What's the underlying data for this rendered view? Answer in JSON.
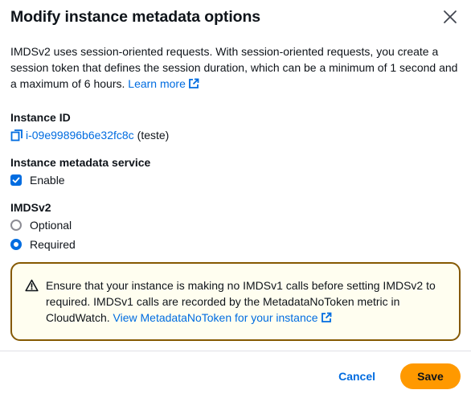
{
  "modal": {
    "title": "Modify instance metadata options",
    "close_icon": "close-icon"
  },
  "description": {
    "text": "IMDSv2 uses session-oriented requests. With session-oriented requests, you create a session token that defines the session duration, which can be a minimum of 1 second and a maximum of 6 hours.",
    "link_label": "Learn more",
    "link_icon": "external-link-icon"
  },
  "instance_id": {
    "label": "Instance ID",
    "copy_icon": "copy-icon",
    "value": "i-09e99896b6e32fc8c",
    "name": "(teste)"
  },
  "metadata_service": {
    "label": "Instance metadata service",
    "checkbox_label": "Enable",
    "checked": true
  },
  "imdsv2": {
    "label": "IMDSv2",
    "options": [
      {
        "label": "Optional",
        "selected": false
      },
      {
        "label": "Required",
        "selected": true
      }
    ]
  },
  "alert": {
    "icon": "warning-icon",
    "text": "Ensure that your instance is making no IMDSv1 calls before setting IMDSv2 to required. IMDSv1 calls are recorded by the MetadataNoToken metric in CloudWatch.",
    "link_label": "View MetadataNoToken for your instance",
    "link_icon": "external-link-icon"
  },
  "footer": {
    "cancel_label": "Cancel",
    "save_label": "Save"
  },
  "colors": {
    "link": "#006ce0",
    "primary_button": "#ff9900",
    "warning_border": "#855900",
    "warning_background": "#fffef0"
  }
}
